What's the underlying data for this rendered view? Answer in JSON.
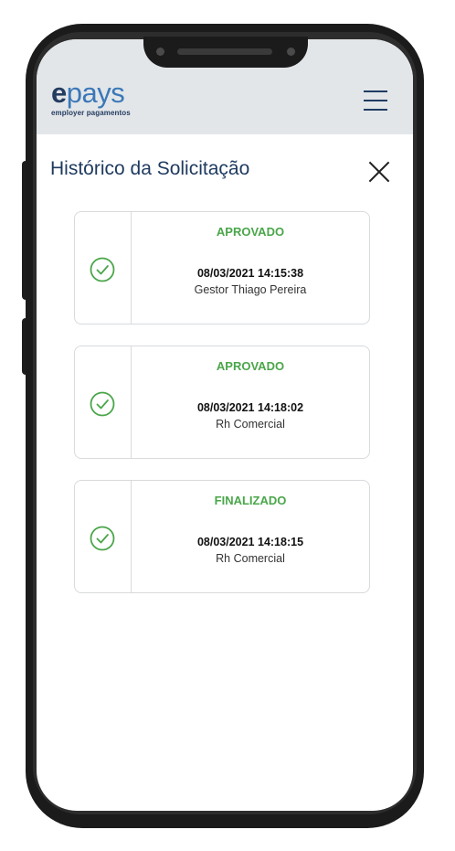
{
  "brand": {
    "logo_main": "pays",
    "logo_e": "e",
    "logo_sub": "employer pagamentos",
    "accent": "#3b78b8",
    "dark": "#1e3a5f"
  },
  "header": {
    "menu_icon": "hamburger-icon"
  },
  "modal": {
    "title": "Histórico da Solicitação",
    "close_icon": "close-icon"
  },
  "history": [
    {
      "status": "APROVADO",
      "datetime": "08/03/2021 14:15:38",
      "by": "Gestor Thiago Pereira",
      "icon": "check-circle-icon"
    },
    {
      "status": "APROVADO",
      "datetime": "08/03/2021 14:18:02",
      "by": "Rh Comercial",
      "icon": "check-circle-icon"
    },
    {
      "status": "FINALIZADO",
      "datetime": "08/03/2021 14:18:15",
      "by": "Rh Comercial",
      "icon": "check-circle-icon"
    }
  ],
  "colors": {
    "status_green": "#4aa64a",
    "header_bg": "#e3e6e9"
  }
}
